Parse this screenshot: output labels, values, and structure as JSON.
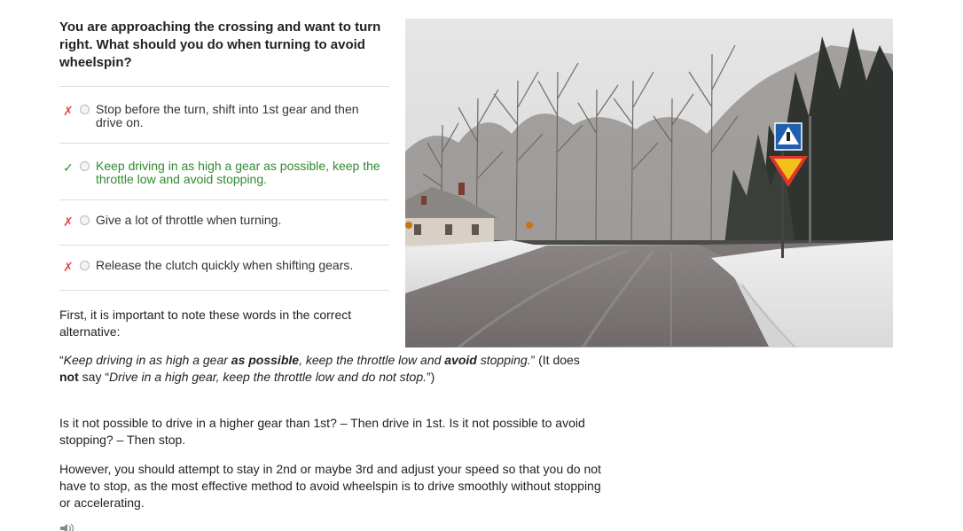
{
  "question": {
    "text": "You are approaching the crossing and want to turn right. What should you do when turning to avoid wheelspin?"
  },
  "answers": [
    {
      "mark": "✗",
      "text": "Stop before the turn, shift into 1st gear and then drive on."
    },
    {
      "mark": "✓",
      "text": "Keep driving in as high a gear as possible, keep the throttle low and avoid stopping."
    },
    {
      "mark": "✗",
      "text": "Give a lot of throttle when turning."
    },
    {
      "mark": "✗",
      "text": "Release the clutch quickly when shifting gears."
    }
  ],
  "explanation": {
    "p1": "First, it is important to note these words in the correct alternative:",
    "p2": {
      "open_quote": "“",
      "q1": "Keep driving in as high a gear ",
      "q1_bold": "as possible",
      "q2": ", keep the throttle low and ",
      "q2_bold": "avoid",
      "q3": " stopping.",
      "close": "” (It does ",
      "not": "not",
      "say": " say “",
      "say_quote": "Drive in a high gear, keep the throttle low and do not stop.",
      "end": "”)"
    },
    "p3": "Is it not possible to drive in a higher gear than 1st? – Then drive in 1st. Is it not possible to avoid stopping? – Then stop.",
    "p4": "However, you should attempt to stay in 2nd or maybe 3rd and adjust your speed so that you do not have to stop, as the most effective method to avoid wheelspin is to drive smoothly without stopping or accelerating."
  },
  "colors": {
    "wrong": "#e04848",
    "correct": "#2f8a2f"
  },
  "icons": {
    "audio": "speaker-icon"
  }
}
